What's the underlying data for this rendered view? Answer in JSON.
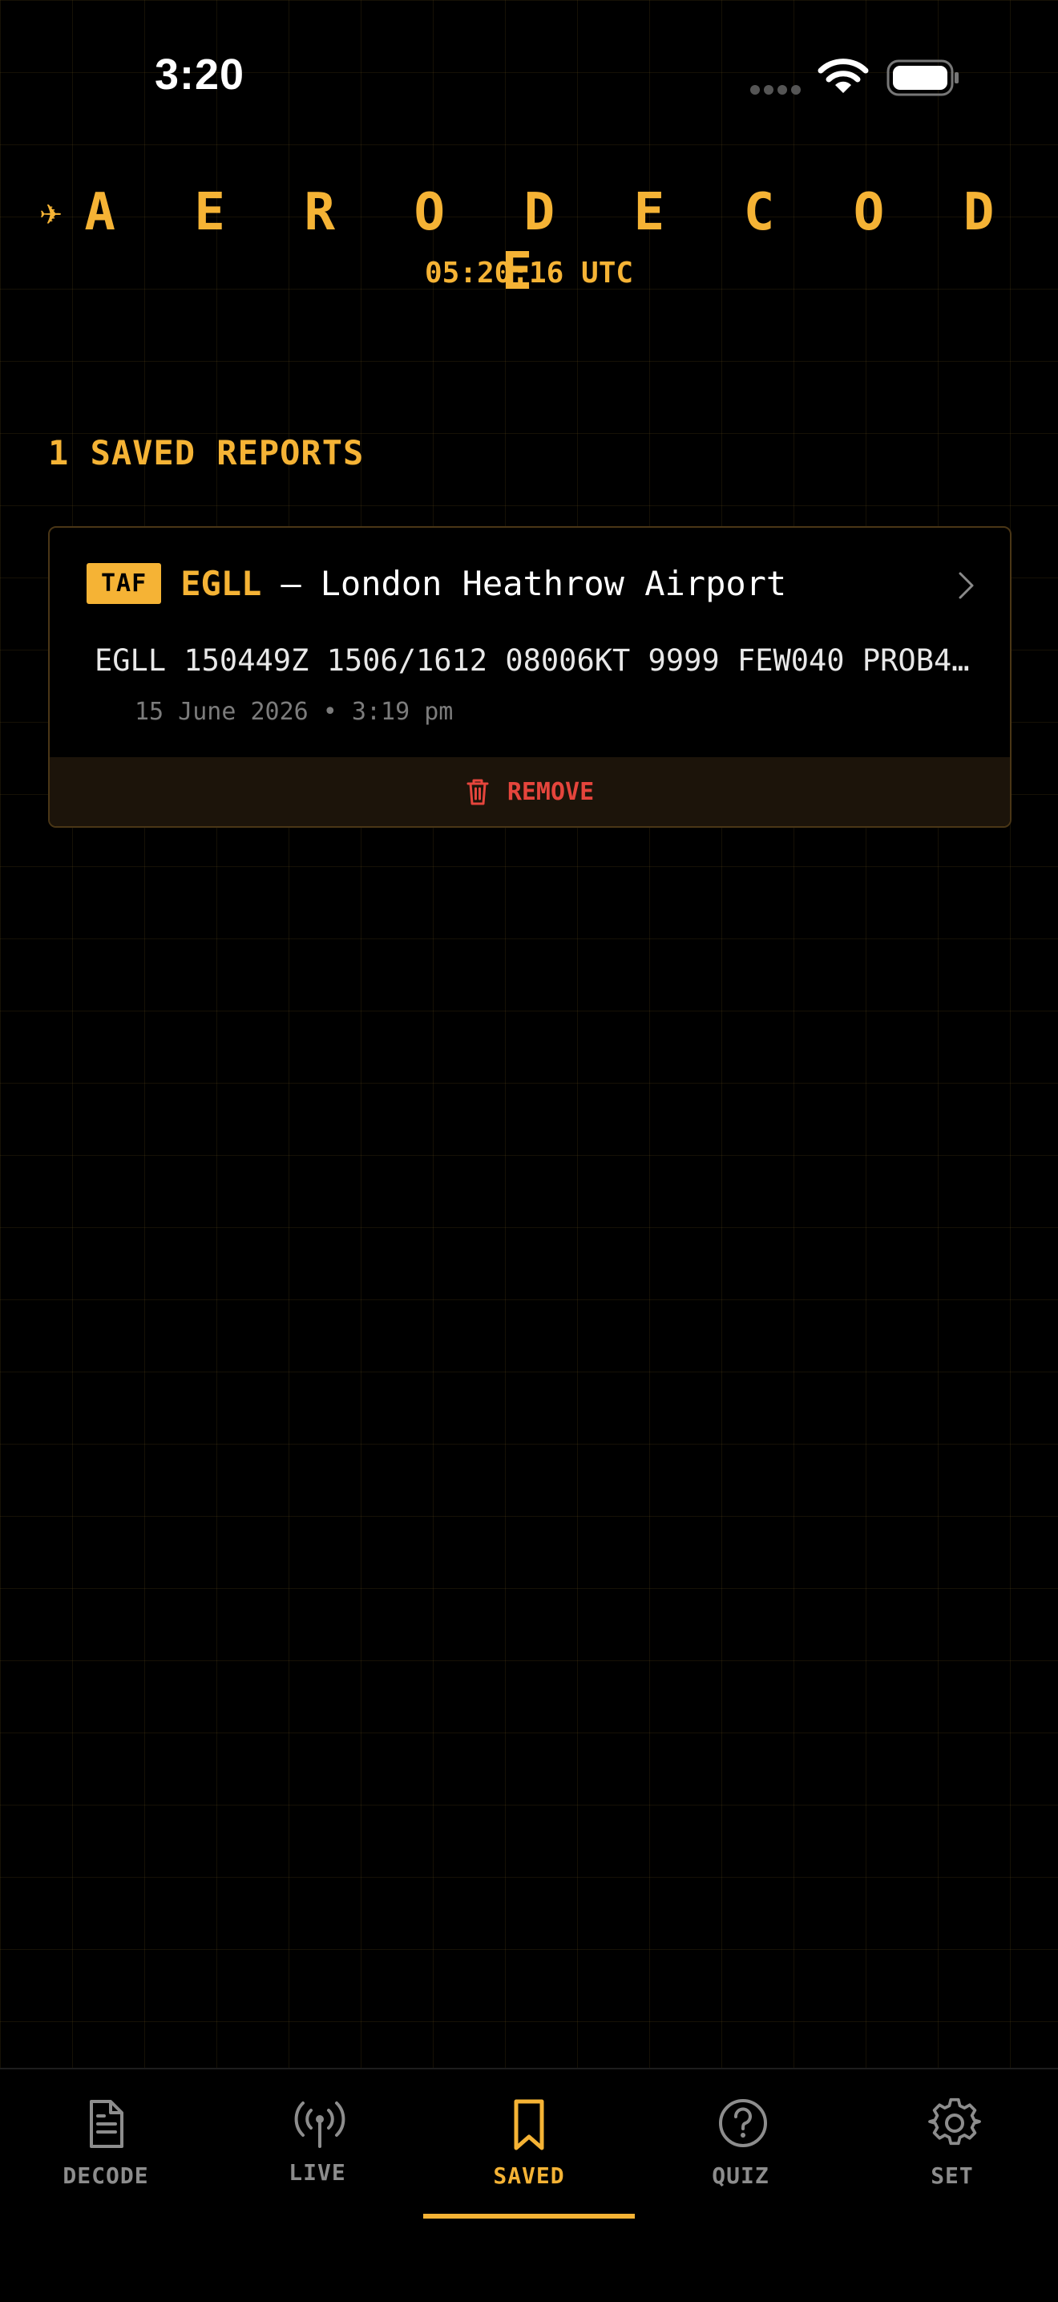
{
  "status_bar": {
    "time": "3:20"
  },
  "header": {
    "title": "A E R O D E C O D E",
    "utc_time": "05:20:16 UTC"
  },
  "saved": {
    "heading": "1 SAVED REPORTS",
    "reports": [
      {
        "type": "TAF",
        "station_code": "EGLL",
        "separator": "—",
        "station_name": "London Heathrow Airport",
        "raw": "EGLL 150449Z 1506/1612 08006KT 9999 FEW040 PROB4…",
        "saved_at": "15 June 2026 • 3:19 pm",
        "remove_label": "REMOVE"
      }
    ]
  },
  "tabs": [
    {
      "label": "DECODE",
      "icon": "document-icon"
    },
    {
      "label": "LIVE",
      "icon": "antenna-icon"
    },
    {
      "label": "SAVED",
      "icon": "bookmark-icon",
      "active": true
    },
    {
      "label": "QUIZ",
      "icon": "question-icon"
    },
    {
      "label": "SET",
      "icon": "gear-icon"
    }
  ],
  "colors": {
    "accent": "#f5b335",
    "danger": "#e5453c",
    "background": "#000000"
  }
}
